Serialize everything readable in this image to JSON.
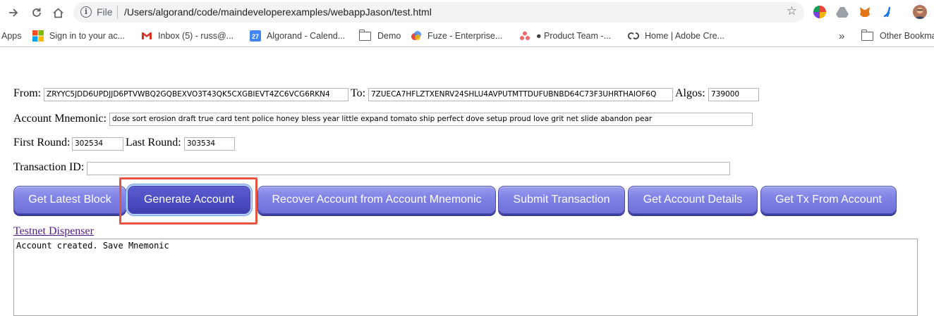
{
  "browser": {
    "url_scheme": "File",
    "url_path": "/Users/algorand/code/maindeveloperexamples/webappJason/test.html",
    "bookmarks": [
      {
        "label": "Apps",
        "icon": "apps-grid-icon"
      },
      {
        "label": "Sign in to your ac...",
        "icon": "microsoft-icon"
      },
      {
        "label": "Inbox (5) - russ@...",
        "icon": "gmail-icon"
      },
      {
        "label": "Algorand - Calend...",
        "icon": "calendar-icon",
        "badge": "27"
      },
      {
        "label": "Demo",
        "icon": "folder-icon"
      },
      {
        "label": "Fuze - Enterprise...",
        "icon": "fuze-icon"
      },
      {
        "label": "● Product Team -...",
        "icon": "asana-icon"
      },
      {
        "label": "Home | Adobe Cre...",
        "icon": "adobe-cc-icon"
      }
    ],
    "overflow": "»",
    "other_bookmarks": "Other Bookma"
  },
  "form": {
    "from_label": "From:",
    "from_value": "ZRYYC5JDD6UPDJJD6PTVWBQ2GQBEXVO3T43QK5CXGBIEVT4ZC6VCG6RKN4",
    "to_label": "To:",
    "to_value": "7ZUECA7HFLZTXENRV24SHLU4AVPUTMTTDUFUBNBD64C73F3UHRTHAIOF6Q",
    "algos_label": "Algos:",
    "algos_value": "739000",
    "mnemonic_label": "Account Mnemonic:",
    "mnemonic_value": "dose sort erosion draft true card tent police honey bless year little expand tomato ship perfect dove setup proud love grit net slide abandon pear",
    "first_round_label": "First Round:",
    "first_round_value": "302534",
    "last_round_label": "Last Round:",
    "last_round_value": "303534",
    "txid_label": "Transaction ID:",
    "txid_value": ""
  },
  "buttons": {
    "get_latest_block": "Get Latest Block",
    "generate_account": "Generate Account",
    "recover_account": "Recover Account from Account Mnemonic",
    "submit_transaction": "Submit Transaction",
    "get_account_details": "Get Account Details",
    "get_tx_from_account": "Get Tx From Account"
  },
  "link": {
    "testnet_dispenser": "Testnet Dispenser"
  },
  "output": {
    "text": "Account created. Save Mnemonic"
  },
  "colors": {
    "button": "#7f81e4",
    "button_focused": "#4a4cc0",
    "highlight": "#e5553f",
    "visited_link": "#551a8b"
  }
}
